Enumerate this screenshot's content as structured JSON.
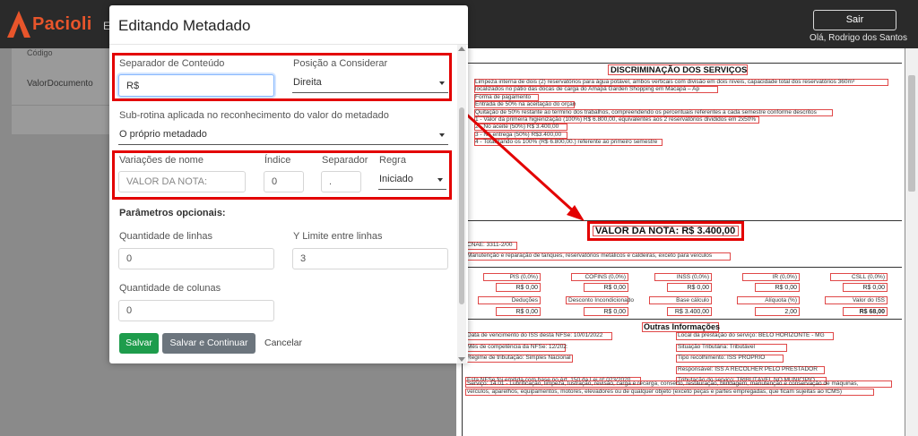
{
  "app": {
    "brand": "Pacioli",
    "nav_peek": "E",
    "logout_label": "Sair",
    "user_name": "Olá, Rodrigo dos Santos"
  },
  "background_list": {
    "row_top": "Código",
    "row": "ValorDocumento"
  },
  "modal": {
    "title": "Editando Metadado",
    "separador_conteudo": {
      "label": "Separador de Conteúdo",
      "value": "R$"
    },
    "posicao": {
      "label": "Posição a Considerar",
      "value": "Direita"
    },
    "subrotina": {
      "label": "Sub-rotina aplicada no reconhecimento do valor do metadado",
      "value": "O próprio metadado"
    },
    "variacoes": {
      "label": "Variações de nome",
      "value": "VALOR DA NOTA:"
    },
    "indice": {
      "label": "Índice",
      "value": "0"
    },
    "separador": {
      "label": "Separador",
      "value": "."
    },
    "regra": {
      "label": "Regra",
      "value": "Iniciado"
    },
    "parametros_title": "Parâmetros opcionais:",
    "qtd_linhas": {
      "label": "Quantidade de linhas",
      "value": "0"
    },
    "y_limite": {
      "label": "Y Limite entre linhas",
      "value": "3"
    },
    "qtd_colunas": {
      "label": "Quantidade de colunas",
      "value": "0"
    },
    "buttons": {
      "save": "Salvar",
      "save_continue": "Salvar e Continuar",
      "cancel": "Cancelar"
    }
  },
  "document": {
    "title": "DISCRIMINAÇÃO DOS SERVIÇOS",
    "service_lines": [
      "Limpeza interna de dois (2) reservatórios para água potável, ambos verticais com divisão em dois níveis, capacidade total dos reservatórios 360m³",
      "localizados no pátio das docas de carga do Amapá Garden Shopping em Macapá – Ap",
      "Forma de pagamento",
      "Entrada de 50% na aceitação do orçamento",
      "Quitação de 50% restante ao termino dos trabalhos, compreendendo os percentuais referentes a cada semestre conforme descritos",
      "1 - Valor da primeira higienização (100%) R$ 6.800,00, equivalentes aos 2 reservatórios divididos em 2x50%",
      "2 - No aceite (50%) R$ 3.400,00",
      "3 - Na entrega (50%) R$3.400,00",
      "4 - Totalizando os 100% (R$ 6.800,00.) referente ao primeiro semestre"
    ],
    "valor_nota": "VALOR DA NOTA: R$ 3.400,00",
    "cnae": "CNAE: 3311-2/00",
    "cnae_desc": "Manutenção e reparação de tanques, reservatórios metálicos e caldeiras, exceto para veículos",
    "tax_row1": [
      {
        "label": "PIS (0,0%)",
        "value": "R$ 0,00"
      },
      {
        "label": "COFINS (0,0%)",
        "value": "R$ 0,00"
      },
      {
        "label": "INSS (0,0%)",
        "value": "R$ 0,00"
      },
      {
        "label": "IR (0,0%)",
        "value": "R$ 0,00"
      },
      {
        "label": "CSLL (0,0%)",
        "value": "R$ 0,00"
      }
    ],
    "tax_row2": [
      {
        "label": "Deduções",
        "value": "R$ 0,00"
      },
      {
        "label": "Desconto Incondicionado",
        "value": "R$ 0,00"
      },
      {
        "label": "Base cálculo",
        "value": "R$ 3.400,00"
      },
      {
        "label": "Alíquota (%)",
        "value": "2,00"
      },
      {
        "label": "Valor do ISS",
        "value": "R$ 68,00"
      }
    ],
    "outras_title": "Outras Informações",
    "outras_left": [
      "Data de vencimento do ISS desta NFSe: 10/01/2022",
      "Mês de competência da NFSe: 12/2021",
      "Regime de tributação: Simples Nacional",
      "",
      "Esta NFSe foi emitida com base no Art. 150 da Lei nº 023/2020"
    ],
    "outras_right": [
      "Local da prestação do serviço: BELO HORIZONTE - MG",
      "Situação Tributária: Tributável",
      "Tipo recolhimento: ISS PRÓPRIO",
      "Responsável: ISS A RECOLHER PELO PRESTADOR",
      "Tributação do serviço: TRIBUTÁVEL NO MUNICÍPIO"
    ],
    "servico_lines": [
      "Serviço: 14.01 - Lubrificação, limpeza, lustração, revisão, carga e recarga, conserto, restauração, blindagem, manutenção e conservação de máquinas,",
      "veículos, aparelhos, equipamentos, motores, elevadores ou de qualquer objeto (exceto peças e partes empregadas, que ficam sujeitas ao ICMS)"
    ]
  },
  "colors": {
    "highlight_red": "#e30000",
    "brand_orange": "#e8552b",
    "save_green": "#1e9c4c"
  }
}
